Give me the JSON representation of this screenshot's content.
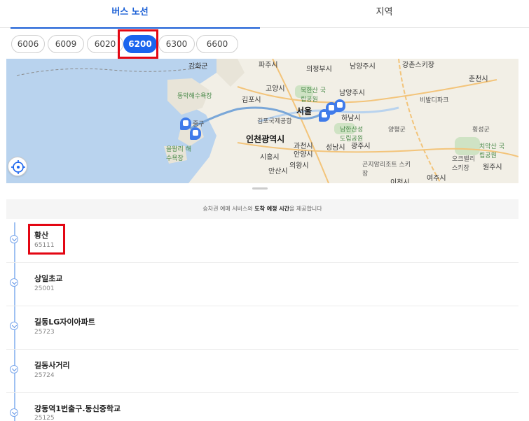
{
  "tabs": [
    {
      "label": "버스 노선",
      "active": true
    },
    {
      "label": "지역",
      "active": false
    }
  ],
  "routes": [
    {
      "label": "6006",
      "selected": false
    },
    {
      "label": "6009",
      "selected": false
    },
    {
      "label": "6020",
      "selected": false
    },
    {
      "label": "6200",
      "selected": true
    },
    {
      "label": "6300",
      "selected": false
    },
    {
      "label": "6600",
      "selected": false
    }
  ],
  "map": {
    "labels": {
      "ganghwa": "강화군",
      "paju": "파주시",
      "uijeongbu": "의정부시",
      "namyangju_top": "남양주시",
      "chuncheon": "춘천시",
      "gangchon": "강촌스키장",
      "dongmak": "동막해수욕장",
      "gimpo": "김포시",
      "goyang": "고양시",
      "bukhansan": "북한산 국립공원",
      "namyangju": "남양주시",
      "biwal": "비발디파크",
      "gimpo_airport": "김포국제공항",
      "seoul": "서울",
      "hanam": "하남시",
      "incheon": "인천광역시",
      "namhansanseong": "남한산성 도립공원",
      "yangpyeong": "양평군",
      "hoengseong": "횡성군",
      "eulwang": "을왕리 해수욕장",
      "gwacheon": "과천시",
      "seongnam": "성남시",
      "gwangju": "광주시",
      "chiak": "치악산 국립공원",
      "siheung": "시흥시",
      "anyang": "안양시",
      "gonjiam": "곤지암리조트 스키장",
      "oak": "오크밸리 스키장",
      "wonju": "원주시",
      "uiwang": "의왕시",
      "ansan": "안산시",
      "icheon": "이천시",
      "yeoju": "여주시",
      "junggu": "중구"
    }
  },
  "notice": {
    "prefix": "승차권 예매 서비스와 ",
    "bold": "도착 예정 시간",
    "suffix": "을 제공합니다"
  },
  "stops": [
    {
      "name": "황산",
      "code": "65111"
    },
    {
      "name": "상일초교",
      "code": "25001"
    },
    {
      "name": "길동LG자이아파트",
      "code": "25723"
    },
    {
      "name": "길동사거리",
      "code": "25724"
    },
    {
      "name": "강동역1번출구.동신중학교",
      "code": "25125"
    }
  ],
  "colors": {
    "accent": "#1a64ee",
    "highlight": "#e30613",
    "route_line": "#7aa7d8",
    "water": "#b9d3ee"
  }
}
